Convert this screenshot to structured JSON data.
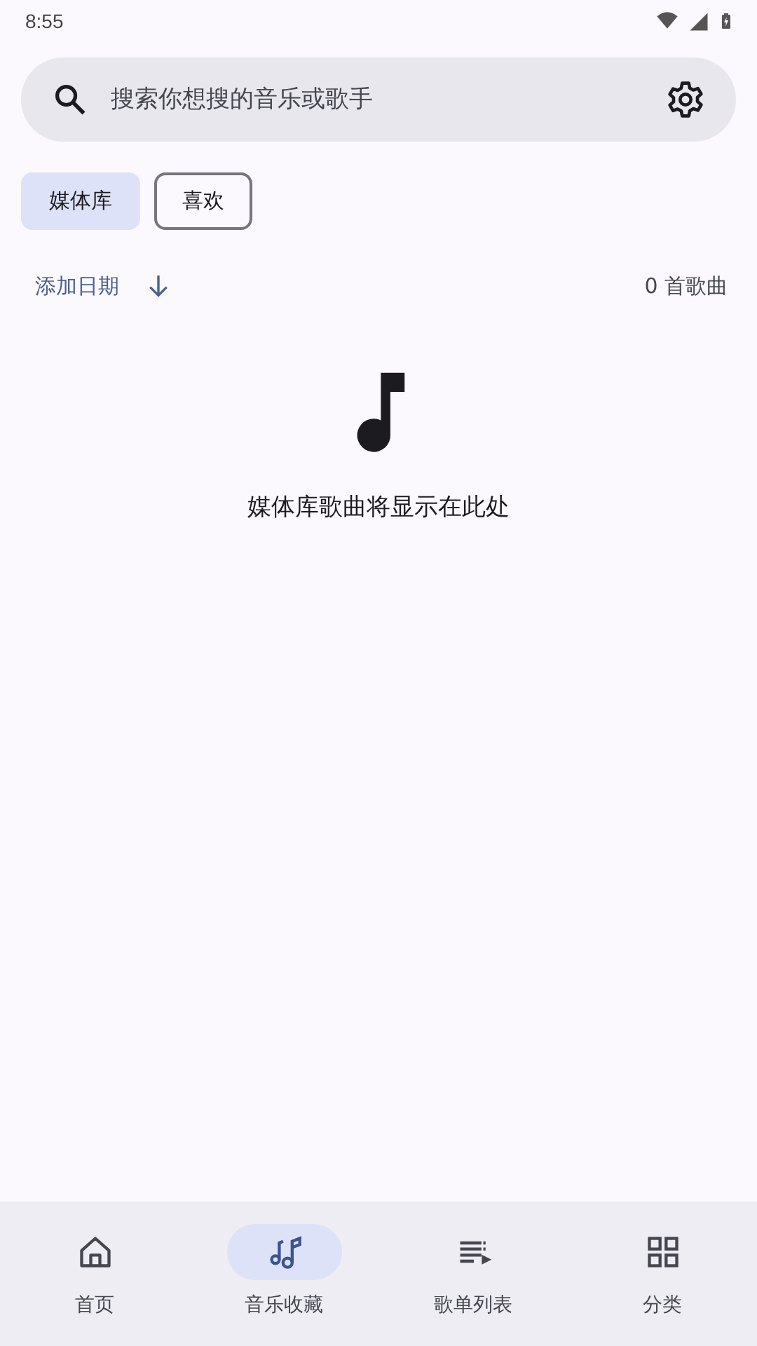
{
  "status_bar": {
    "time": "8:55"
  },
  "search": {
    "placeholder": "搜索你想搜的音乐或歌手"
  },
  "chips": [
    {
      "label": "媒体库",
      "selected": true
    },
    {
      "label": "喜欢",
      "selected": false
    }
  ],
  "sort": {
    "label": "添加日期",
    "count": "0 首歌曲"
  },
  "empty_state": {
    "message": "媒体库歌曲将显示在此处"
  },
  "nav": [
    {
      "kind": "home",
      "label": "首页",
      "selected": false
    },
    {
      "kind": "music",
      "label": "音乐收藏",
      "selected": true
    },
    {
      "kind": "playlist",
      "label": "歌单列表",
      "selected": false
    },
    {
      "kind": "grid",
      "label": "分类",
      "selected": false
    }
  ]
}
